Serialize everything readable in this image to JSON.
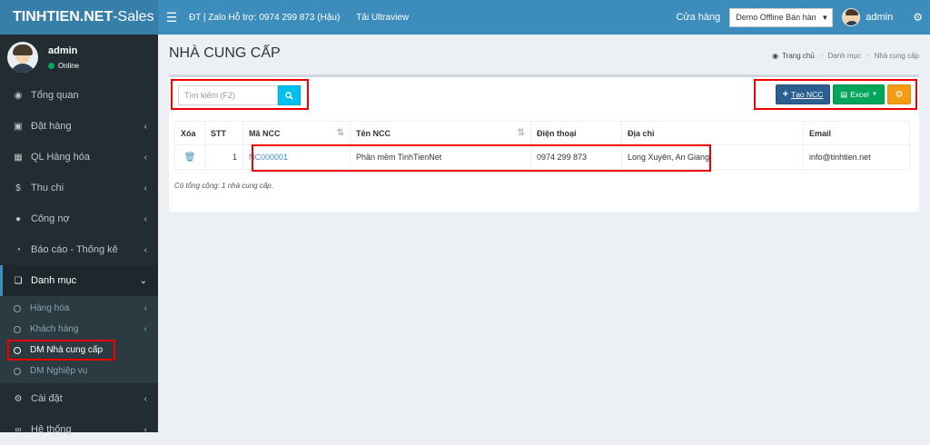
{
  "header": {
    "logo_bold": "TINHTIEN.NET",
    "logo_rest": "-Sales",
    "support": "ĐT | Zalo Hỗ trợ: 0974 299 873 (Hậu)",
    "ultraview": "Tải Ultraview",
    "store_label": "Cửa hàng",
    "store_value": "Demo Offline Bán hàn",
    "user": "admin"
  },
  "sidebar": {
    "user_name": "admin",
    "user_status": "Online",
    "items": [
      {
        "label": "Tổng quan",
        "icon": "dashboard-icon"
      },
      {
        "label": "Đặt hàng",
        "icon": "cart-icon"
      },
      {
        "label": "QL Hàng hóa",
        "icon": "barcode-icon"
      },
      {
        "label": "Thu chi",
        "icon": "dollar-icon"
      },
      {
        "label": "Công nợ",
        "icon": "user-icon"
      },
      {
        "label": "Báo cáo - Thống kê",
        "icon": "pie-chart-icon"
      },
      {
        "label": "Danh mục",
        "icon": "copy-icon"
      },
      {
        "label": "Cài đặt",
        "icon": "gear-icon"
      },
      {
        "label": "Hệ thống",
        "icon": "link-icon"
      }
    ],
    "sub_items": [
      {
        "label": "Hàng hóa"
      },
      {
        "label": "Khách hàng"
      },
      {
        "label": "DM Nhà cung cấp"
      },
      {
        "label": "DM Nghiệp vụ"
      }
    ]
  },
  "page": {
    "title": "NHÀ CUNG CẤP",
    "breadcrumb": [
      "Trang chủ",
      "Danh mục",
      "Nhà cung cấp"
    ]
  },
  "toolbar": {
    "search_placeholder": "Tìm kiếm (F2)",
    "create_label": "Tạo NCC",
    "excel_label": "Excel"
  },
  "table": {
    "headers": [
      "Xóa",
      "STT",
      "Mã NCC",
      "Tên NCC",
      "Điện thoại",
      "Địa chỉ",
      "Email"
    ],
    "rows": [
      {
        "stt": "1",
        "code": "NC000001",
        "name": "Phần mềm TinhTienNet",
        "phone": "0974 299 873",
        "address": "Long Xuyên, An Giang",
        "email": "info@tinhtien.net"
      }
    ],
    "total": "Có tổng cộng: 1 nhà cung cấp."
  },
  "colors": {
    "header": "#3c8dbc",
    "sidebar": "#222d32",
    "highlight": "#ee0000",
    "create_button": "#2a5f8f",
    "excel_button": "#00a65a",
    "setting_button": "#f39c12"
  }
}
